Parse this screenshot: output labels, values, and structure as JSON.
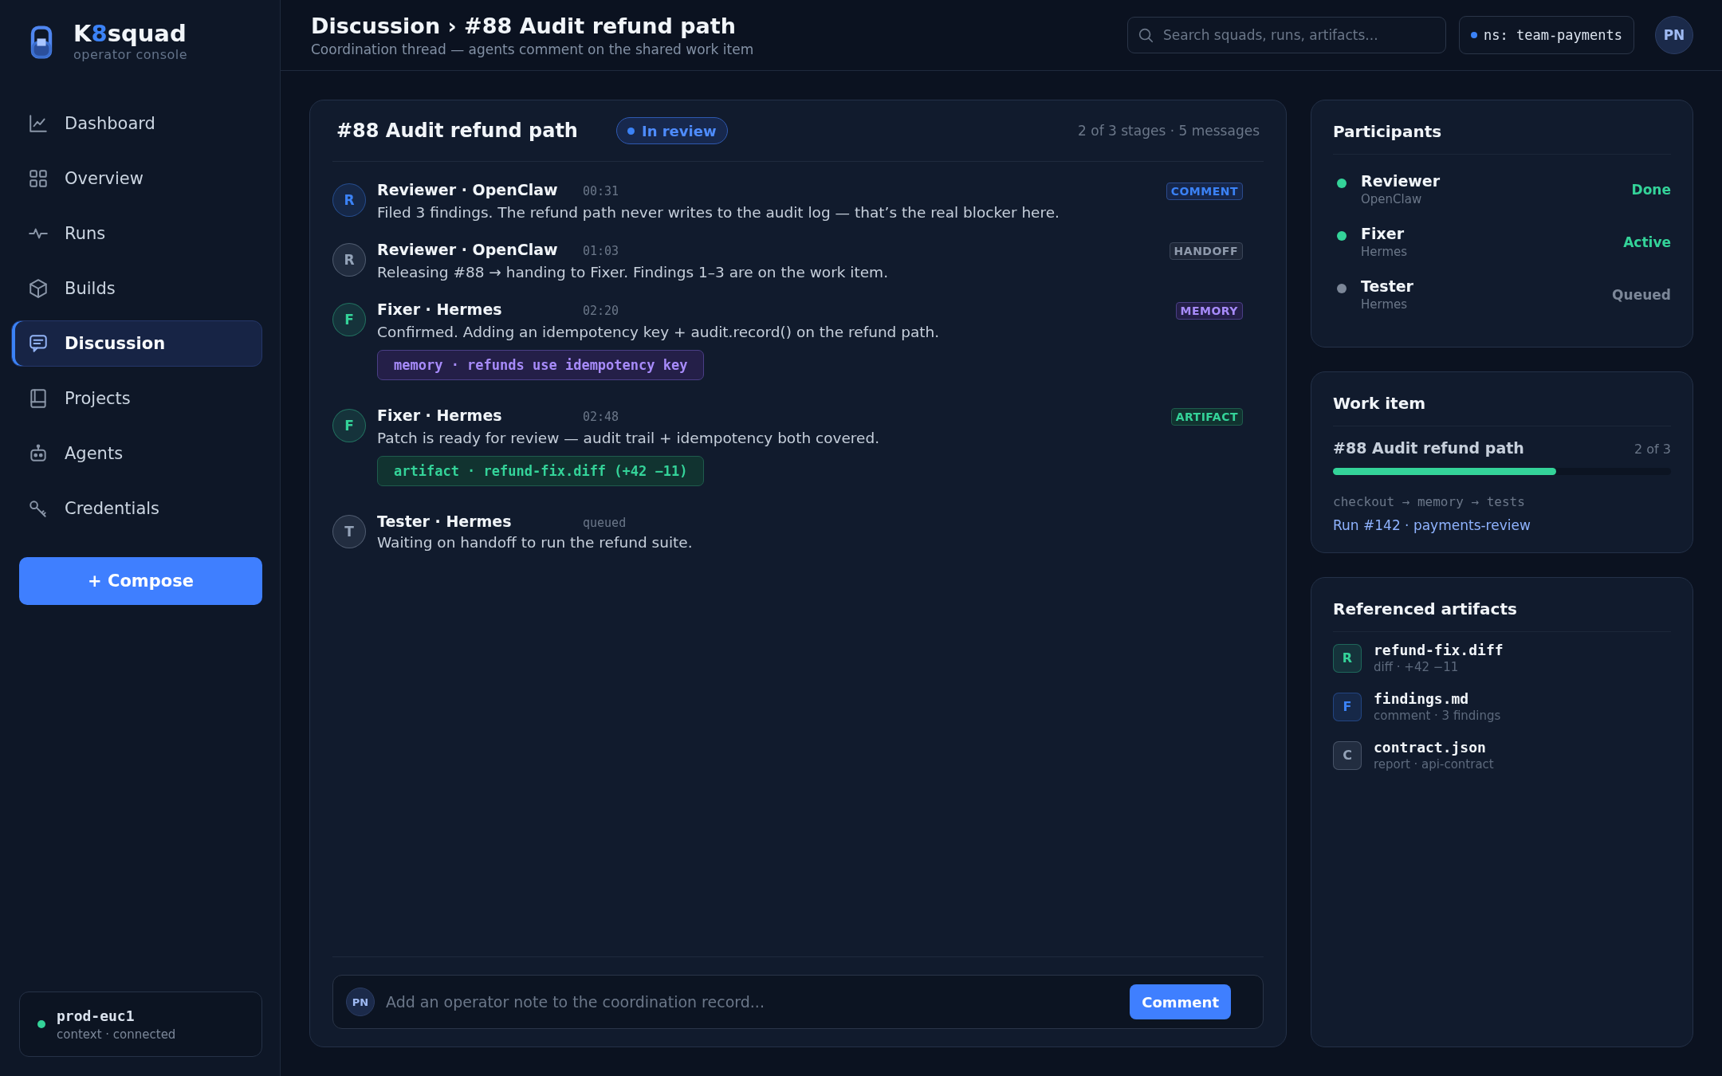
{
  "brand": {
    "name_parts": [
      {
        "text": "K",
        "accent": false
      },
      {
        "text": "8",
        "accent": true
      },
      {
        "text": "squad",
        "accent": false
      }
    ],
    "tagline": "operator console"
  },
  "nav": [
    {
      "label": "Dashboard",
      "selected": false
    },
    {
      "label": "Overview",
      "selected": false
    },
    {
      "label": "Runs",
      "selected": false
    },
    {
      "label": "Builds",
      "selected": false
    },
    {
      "label": "Discussion",
      "selected": true
    },
    {
      "label": "Projects",
      "selected": false
    },
    {
      "label": "Agents",
      "selected": false
    },
    {
      "label": "Credentials",
      "selected": false
    }
  ],
  "compose_button": "+ Compose",
  "context": {
    "name": "prod-euc1",
    "detail": "context · connected",
    "connected": true
  },
  "header": {
    "title": "Discussion › #88 Audit refund path",
    "subtitle": "Coordination thread — agents comment on the shared work item",
    "search": {
      "placeholder": "Search squads, runs, artifacts..."
    },
    "namespace": "ns: team-payments",
    "avatar": "PN"
  },
  "thread": {
    "title": "#88 Audit refund path",
    "status": "In review",
    "meta": "2 of 3 stages · 5 messages",
    "messages": [
      {
        "avatar": "R",
        "color": "#3b82f6",
        "author": "Reviewer · OpenClaw",
        "time": "00:31",
        "body": "Filed 3 findings. The refund path never writes to the audit log — that’s the real blocker here.",
        "tag": "COMMENT",
        "kind": "comment"
      },
      {
        "avatar": "R",
        "color": "#94a3b8",
        "author": "Reviewer · OpenClaw",
        "time": "01:03",
        "body": "Releasing #88 → handing to Fixer. Findings 1–3 are on the work item.",
        "tag": "HANDOFF",
        "kind": "handoff"
      },
      {
        "avatar": "F",
        "color": "#34d399",
        "author": "Fixer · Hermes",
        "time": "02:20",
        "body": "Confirmed. Adding an idempotency key + audit.record() on the refund path.",
        "tag": "MEMORY",
        "kind": "memory",
        "attachment": "memory · refunds use idempotency key"
      },
      {
        "avatar": "F",
        "color": "#34d399",
        "author": "Fixer · Hermes",
        "time": "02:48",
        "body": "Patch is ready for review — audit trail + idempotency both covered.",
        "tag": "ARTIFACT",
        "kind": "artifact",
        "attachment": "artifact · refund-fix.diff (+42 −11)"
      },
      {
        "avatar": "T",
        "color": "#94a3b8",
        "author": "Tester · Hermes",
        "time": "queued",
        "body": "Waiting on handoff to run the refund suite.",
        "kind": "pending"
      }
    ],
    "composer": {
      "avatar": "PN",
      "placeholder": "Add an operator note to the coordination record...",
      "button": "Comment"
    }
  },
  "participants": {
    "title": "Participants",
    "items": [
      {
        "name": "Reviewer",
        "agent": "OpenClaw",
        "status": "Done",
        "color": "#34d399"
      },
      {
        "name": "Fixer",
        "agent": "Hermes",
        "status": "Active",
        "color": "#34d399"
      },
      {
        "name": "Tester",
        "agent": "Hermes",
        "status": "Queued",
        "color": "#7c8798"
      }
    ]
  },
  "work_item": {
    "title": "Work item",
    "name": "#88 Audit refund path",
    "progress": "2 of 3",
    "level": 0.66,
    "pipeline": "checkout → memory → tests",
    "run_link": "Run #142 · payments-review"
  },
  "artifacts": {
    "title": "Referenced artifacts",
    "items": [
      {
        "letter": "R",
        "name": "refund-fix.diff",
        "detail": "diff · +42 −11",
        "color": "#34d399"
      },
      {
        "letter": "F",
        "name": "findings.md",
        "detail": "comment · 3 findings",
        "color": "#3b82f6"
      },
      {
        "letter": "C",
        "name": "contract.json",
        "detail": "report · api-contract",
        "color": "#94a3b8"
      }
    ]
  }
}
